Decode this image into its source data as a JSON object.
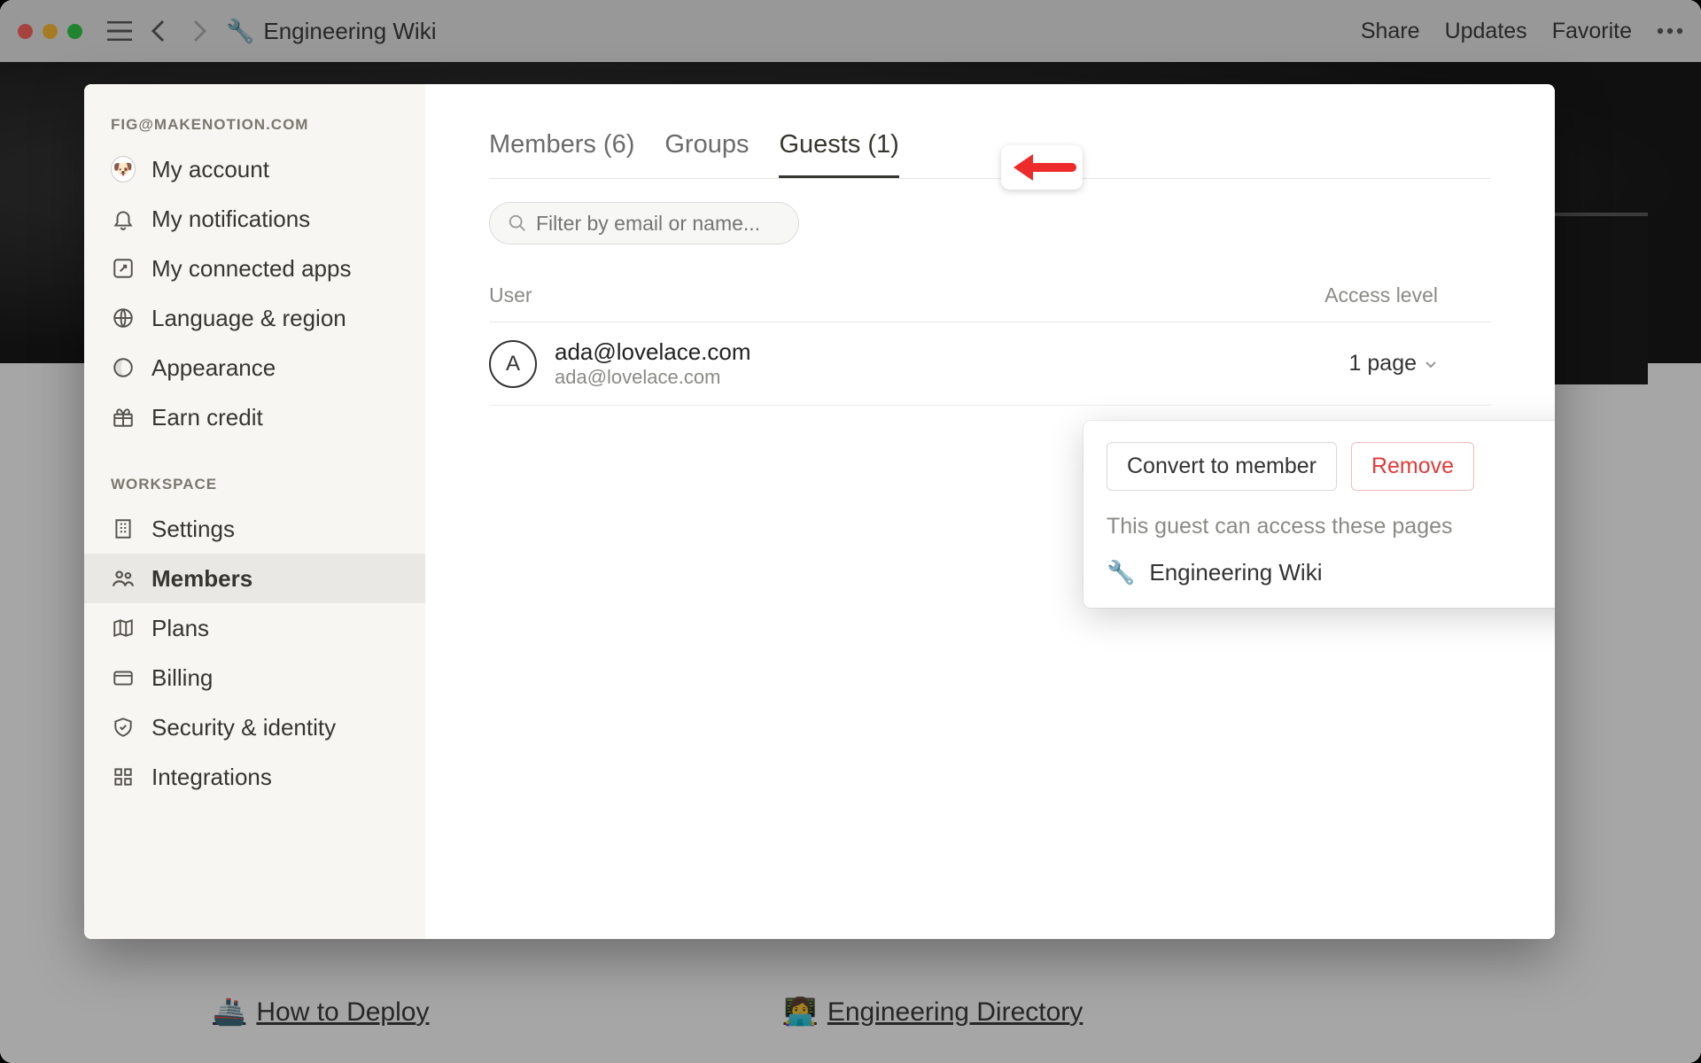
{
  "topbar": {
    "page_icon": "🔧",
    "page_title": "Engineering Wiki",
    "actions": {
      "share": "Share",
      "updates": "Updates",
      "favorite": "Favorite"
    }
  },
  "page_links": [
    {
      "emoji": "🚢",
      "label": "How to Deploy"
    },
    {
      "emoji": "👩‍💻",
      "label": "Engineering Directory"
    }
  ],
  "sidebar": {
    "account_label": "FIG@MAKENOTION.COM",
    "account_items": [
      {
        "label": "My account"
      },
      {
        "label": "My notifications"
      },
      {
        "label": "My connected apps"
      },
      {
        "label": "Language & region"
      },
      {
        "label": "Appearance"
      },
      {
        "label": "Earn credit"
      }
    ],
    "workspace_label": "WORKSPACE",
    "workspace_items": [
      {
        "label": "Settings"
      },
      {
        "label": "Members"
      },
      {
        "label": "Plans"
      },
      {
        "label": "Billing"
      },
      {
        "label": "Security & identity"
      },
      {
        "label": "Integrations"
      }
    ]
  },
  "tabs": {
    "members": "Members (6)",
    "groups": "Groups",
    "guests": "Guests (1)"
  },
  "filter": {
    "placeholder": "Filter by email or name..."
  },
  "table": {
    "col_user": "User",
    "col_access": "Access level"
  },
  "guests": [
    {
      "initial": "A",
      "name": "ada@lovelace.com",
      "email": "ada@lovelace.com",
      "access": "1 page"
    }
  ],
  "popover": {
    "convert": "Convert to member",
    "remove": "Remove",
    "note": "This guest can access these pages",
    "pages": [
      {
        "icon": "🔧",
        "label": "Engineering Wiki"
      }
    ]
  }
}
